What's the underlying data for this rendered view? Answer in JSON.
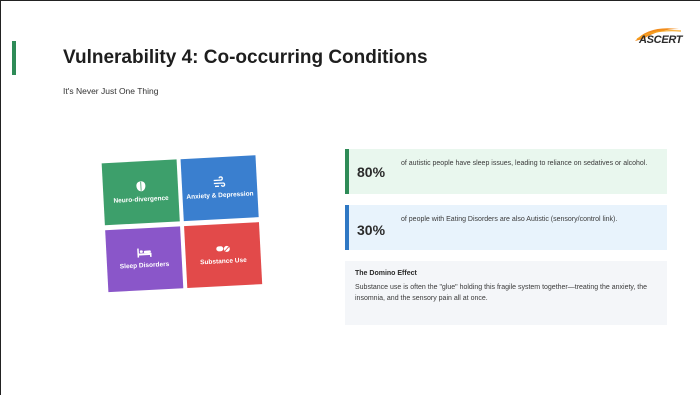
{
  "slide": {
    "title": "Vulnerability 4: Co-occurring Conditions",
    "subtitle": "It's Never Just One Thing",
    "logo_text": "ASCERT"
  },
  "tiles": [
    {
      "label": "Neuro-divergence",
      "icon": "brain-icon",
      "color": "#3d9f6b"
    },
    {
      "label": "Anxiety & Depression",
      "icon": "wind-icon",
      "color": "#3a7fcf"
    },
    {
      "label": "Sleep Disorders",
      "icon": "bed-icon",
      "color": "#8a56c9"
    },
    {
      "label": "Substance Use",
      "icon": "pills-icon",
      "color": "#e24a4a"
    }
  ],
  "stats": [
    {
      "value": "80%",
      "text": "of autistic people have sleep issues, leading to reliance on sedatives or alcohol.",
      "color": "#2e8b57"
    },
    {
      "value": "30%",
      "text": "of people with Eating Disorders are also Autistic (sensory/control link).",
      "color": "#2f78c4"
    }
  ],
  "domino": {
    "title": "The Domino Effect",
    "text": "Substance use is often the \"glue\" holding this fragile system together—treating the anxiety, the insomnia, and the sensory pain all at once."
  }
}
